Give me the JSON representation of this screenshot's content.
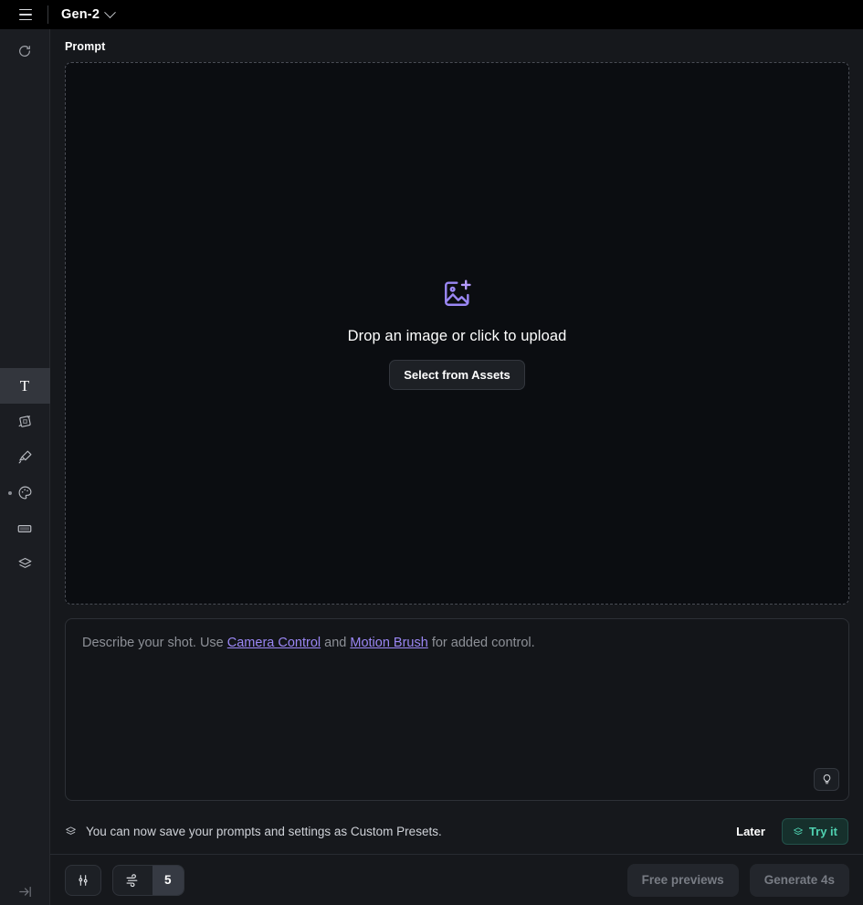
{
  "topbar": {
    "menu_icon": "hamburger-icon",
    "model_name": "Gen-2",
    "chevron_icon": "chevron-down-icon"
  },
  "rail": {
    "history_icon": "history-rotate-icon",
    "tools": [
      {
        "name": "text",
        "icon": "text-t-icon",
        "label": "T",
        "active": true,
        "dot": false
      },
      {
        "name": "camera-control",
        "icon": "camera-control-icon",
        "label": "",
        "active": false,
        "dot": false
      },
      {
        "name": "motion-brush",
        "icon": "motion-brush-icon",
        "label": "",
        "active": false,
        "dot": false
      },
      {
        "name": "style",
        "icon": "palette-icon",
        "label": "",
        "active": false,
        "dot": true
      },
      {
        "name": "aspect-ratio",
        "icon": "rectangle-icon",
        "label": "",
        "active": false,
        "dot": false
      },
      {
        "name": "presets",
        "icon": "layers-icon",
        "label": "",
        "active": false,
        "dot": false
      }
    ],
    "expand_icon": "expand-panel-icon"
  },
  "panel": {
    "title": "Prompt",
    "dropzone": {
      "icon": "image-add-icon",
      "text": "Drop an image or click to upload",
      "button": "Select from Assets"
    },
    "prompt_input": {
      "value": "",
      "placeholder_parts": {
        "p1": "Describe your shot. Use ",
        "link1": "Camera Control",
        "p2": " and ",
        "link2": "Motion Brush",
        "p3": " for added control."
      },
      "suggest_icon": "lightbulb-icon"
    }
  },
  "notice": {
    "icon": "layers-icon",
    "text": "You can now save your prompts and settings as Custom Presets.",
    "later_label": "Later",
    "tryit_label": "Try it",
    "tryit_icon": "layers-icon"
  },
  "bottombar": {
    "settings_icon": "sliders-settings-icon",
    "motion": {
      "icon": "wind-motion-icon",
      "value": "5"
    },
    "free_previews_label": "Free previews",
    "generate_label": "Generate 4s"
  },
  "colors": {
    "accent_purple": "#9b87f5",
    "accent_teal": "#4fd1b0",
    "topbar_bg": "#000000",
    "app_bg": "#16181c",
    "rail_bg": "#1b1d22"
  }
}
